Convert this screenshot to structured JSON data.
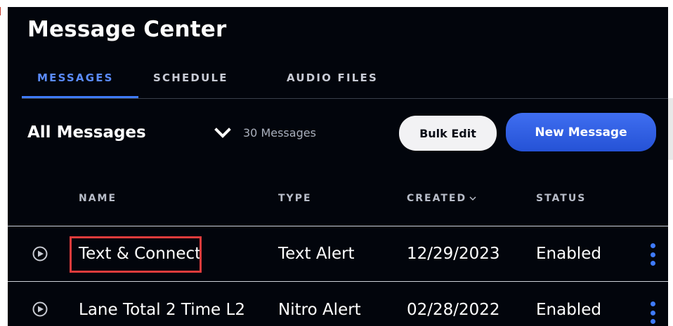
{
  "app": {
    "title": "Message Center"
  },
  "tabs": [
    {
      "label": "MESSAGES",
      "active": true
    },
    {
      "label": "SCHEDULE",
      "active": false
    },
    {
      "label": "AUDIO FILES",
      "active": false
    }
  ],
  "toolbar": {
    "filter_label": "All Messages",
    "count_text": "30 Messages",
    "bulk_edit_label": "Bulk Edit",
    "new_message_label": "New Message"
  },
  "table": {
    "headers": {
      "name": "NAME",
      "type": "TYPE",
      "created": "CREATED",
      "status": "STATUS"
    },
    "rows": [
      {
        "name": "Text & Connect",
        "type": "Text Alert",
        "created": "12/29/2023",
        "status": "Enabled"
      },
      {
        "name": "Lane Total 2 Time L2",
        "type": "Nitro Alert",
        "created": "02/28/2022",
        "status": "Enabled"
      }
    ]
  },
  "colors": {
    "background": "#02050c",
    "accent": "#3f7bff",
    "active_tab": "#5b8cff",
    "highlight": "#e03c3c"
  },
  "icons": {
    "filter_toggle": "chevron-down-icon",
    "sort": "small-chevron-down-icon",
    "row_play": "play-circle-icon",
    "row_menu": "kebab-menu-icon"
  }
}
